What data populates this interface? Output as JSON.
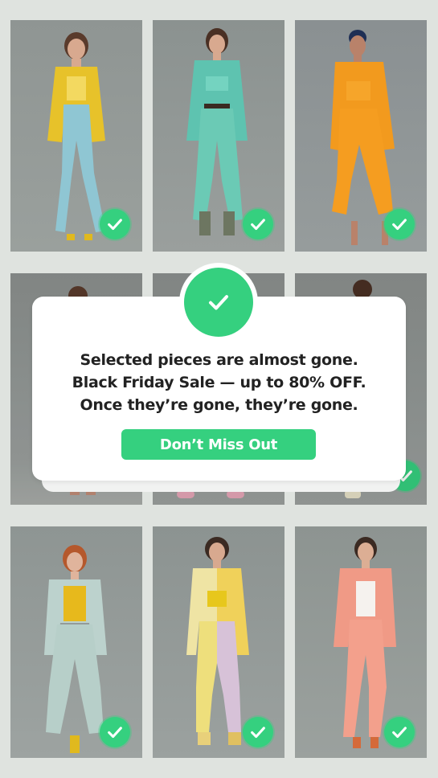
{
  "products": [
    {
      "outfit": "yellow blazer, light blue trousers",
      "selected": true
    },
    {
      "outfit": "mint green suit",
      "selected": true
    },
    {
      "outfit": "orange two-piece",
      "selected": true
    },
    {
      "outfit": "partially hidden",
      "selected": false
    },
    {
      "outfit": "partially hidden",
      "selected": false
    },
    {
      "outfit": "partially hidden",
      "selected": true
    },
    {
      "outfit": "light grey suit, yellow top",
      "selected": true
    },
    {
      "outfit": "yellow and lilac split suit",
      "selected": true
    },
    {
      "outfit": "peach pink suit",
      "selected": true
    }
  ],
  "modal": {
    "line1": "Selected pieces are almost gone.",
    "line2": "Black Friday Sale — up to 80% OFF.",
    "line3": "Once they’re gone, they’re gone.",
    "cta_label": "Don’t Miss Out"
  },
  "colors": {
    "accent": "#35d07f",
    "background": "#dfe3df",
    "modal_bg": "#ffffff",
    "text": "#222222"
  }
}
